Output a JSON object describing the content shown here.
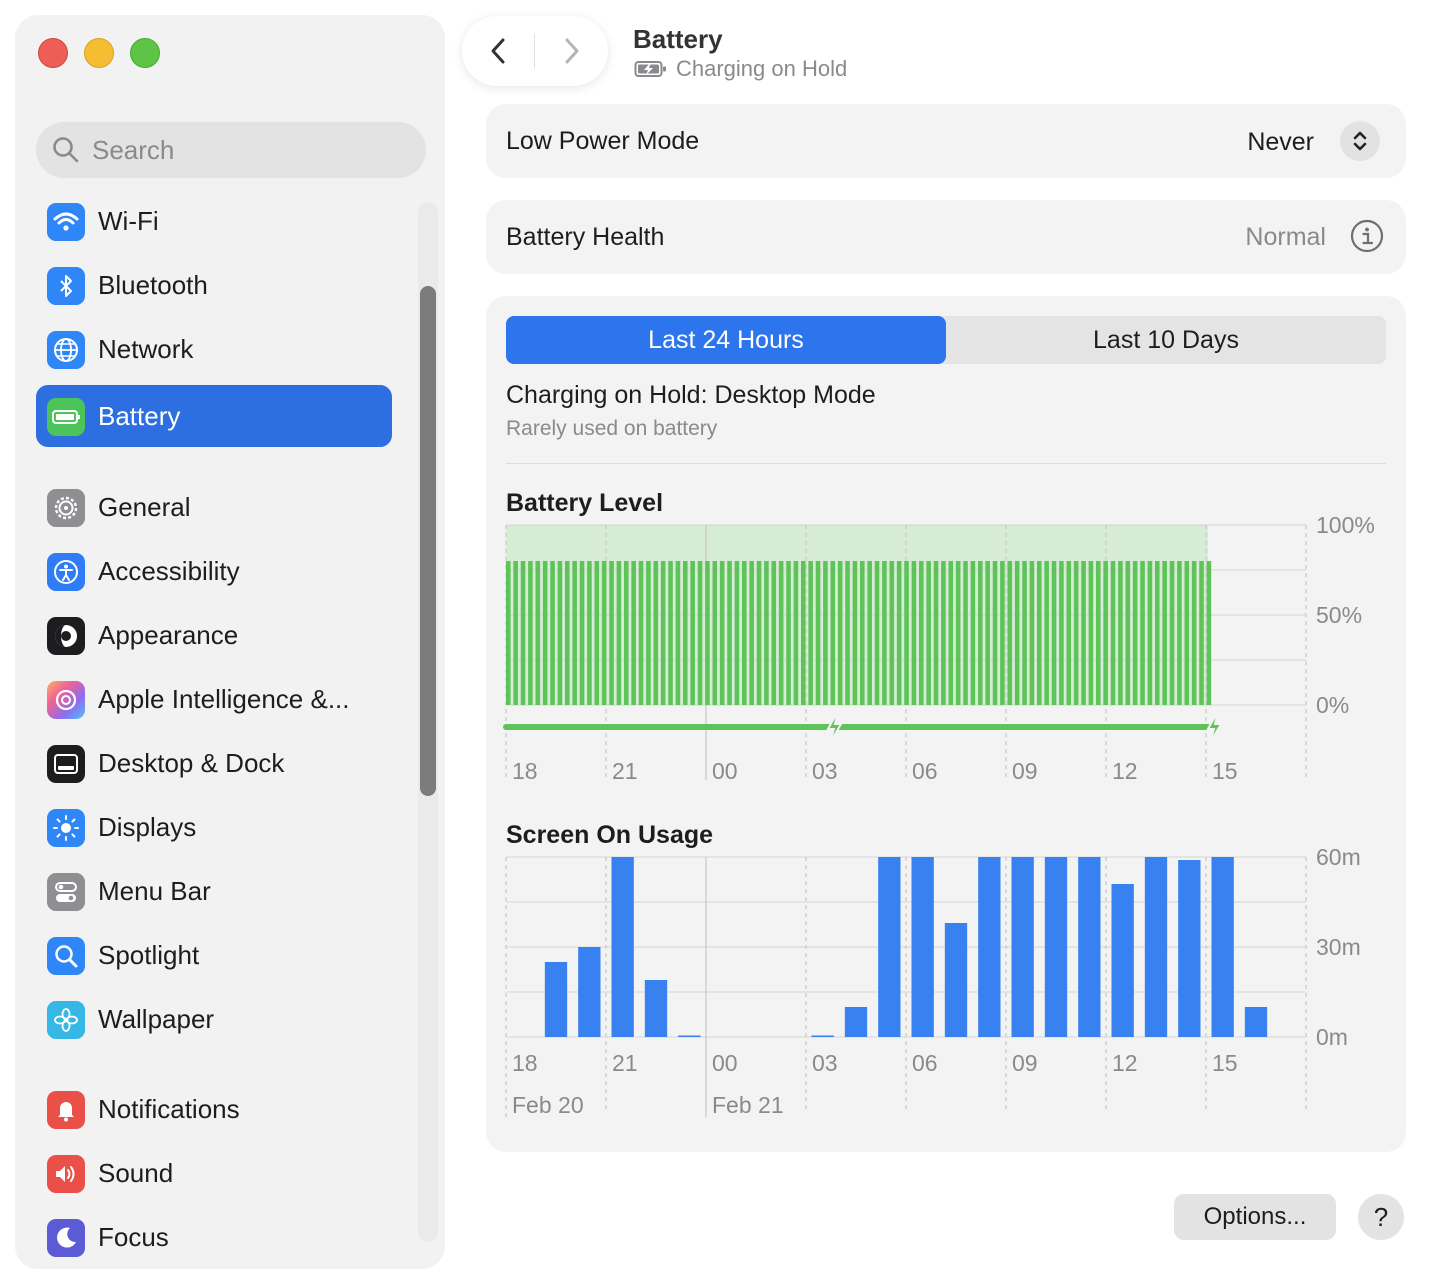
{
  "window": {
    "title": "Battery",
    "subtitle": "Charging on Hold"
  },
  "sidebar": {
    "search_placeholder": "Search",
    "items": [
      {
        "label": "Wi-Fi",
        "icon": "wifi-icon",
        "color": "#3b82f6"
      },
      {
        "label": "Bluetooth",
        "icon": "bluetooth-icon",
        "color": "#3b82f6"
      },
      {
        "label": "Network",
        "icon": "globe-icon",
        "color": "#3b82f6"
      },
      {
        "label": "Battery",
        "icon": "battery-icon",
        "color": "#4cc45a",
        "active": true
      },
      {
        "label": "General",
        "icon": "gear-icon",
        "color": "#8e8e93"
      },
      {
        "label": "Accessibility",
        "icon": "accessibility-icon",
        "color": "#2f7cf6"
      },
      {
        "label": "Appearance",
        "icon": "appearance-icon",
        "color": "#1d1d1f"
      },
      {
        "label": "Apple Intelligence &...",
        "icon": "apple-intelligence-icon",
        "color": "#f06292"
      },
      {
        "label": "Desktop & Dock",
        "icon": "dock-icon",
        "color": "#1d1d1f"
      },
      {
        "label": "Displays",
        "icon": "sun-icon",
        "color": "#3b82f6"
      },
      {
        "label": "Menu Bar",
        "icon": "toggles-icon",
        "color": "#8e8e93"
      },
      {
        "label": "Spotlight",
        "icon": "magnifier-icon",
        "color": "#3b82f6"
      },
      {
        "label": "Wallpaper",
        "icon": "flower-icon",
        "color": "#36b7e6"
      },
      {
        "label": "Notifications",
        "icon": "bell-icon",
        "color": "#ea4f48"
      },
      {
        "label": "Sound",
        "icon": "speaker-icon",
        "color": "#ea4f48"
      },
      {
        "label": "Focus",
        "icon": "moon-icon",
        "color": "#5b5bd6"
      }
    ]
  },
  "settings": {
    "low_power_label": "Low Power Mode",
    "low_power_value": "Never",
    "health_label": "Battery Health",
    "health_value": "Normal"
  },
  "usage": {
    "tabs": [
      "Last 24 Hours",
      "Last 10 Days"
    ],
    "selected_tab": 0,
    "mode_title": "Charging on Hold: Desktop Mode",
    "mode_subtitle": "Rarely used on battery",
    "battery_title": "Battery Level",
    "screen_title": "Screen On Usage"
  },
  "chart_data": [
    {
      "type": "bar",
      "title": "Battery Level",
      "x_tick_labels": [
        "18",
        "21",
        "00",
        "03",
        "06",
        "09",
        "12",
        "15"
      ],
      "y_tick_labels": [
        "100%",
        "50%",
        "0%"
      ],
      "ylim": [
        0,
        100
      ],
      "bar_count": 96,
      "values_percent": 80,
      "charging_events_tick_index": [
        3,
        6.8
      ],
      "color": "#5ec45a",
      "fill_color": "#d6ecd4",
      "grid": true
    },
    {
      "type": "bar",
      "title": "Screen On Usage",
      "x_tick_labels": [
        "18",
        "21",
        "00",
        "03",
        "06",
        "09",
        "12",
        "15"
      ],
      "date_labels": [
        "Feb 20",
        "Feb 21"
      ],
      "y_tick_labels": [
        "60m",
        "30m",
        "0m"
      ],
      "ylim": [
        0,
        60
      ],
      "series": [
        {
          "values_minutes": [
            0,
            25,
            30,
            60,
            19,
            0.5,
            0,
            0,
            0,
            0.5,
            10,
            60,
            60,
            38,
            60,
            60,
            60,
            60,
            51,
            60,
            59,
            60,
            10
          ]
        }
      ],
      "color": "#3781f0",
      "grid": true
    }
  ],
  "buttons": {
    "options": "Options...",
    "help": "?"
  }
}
